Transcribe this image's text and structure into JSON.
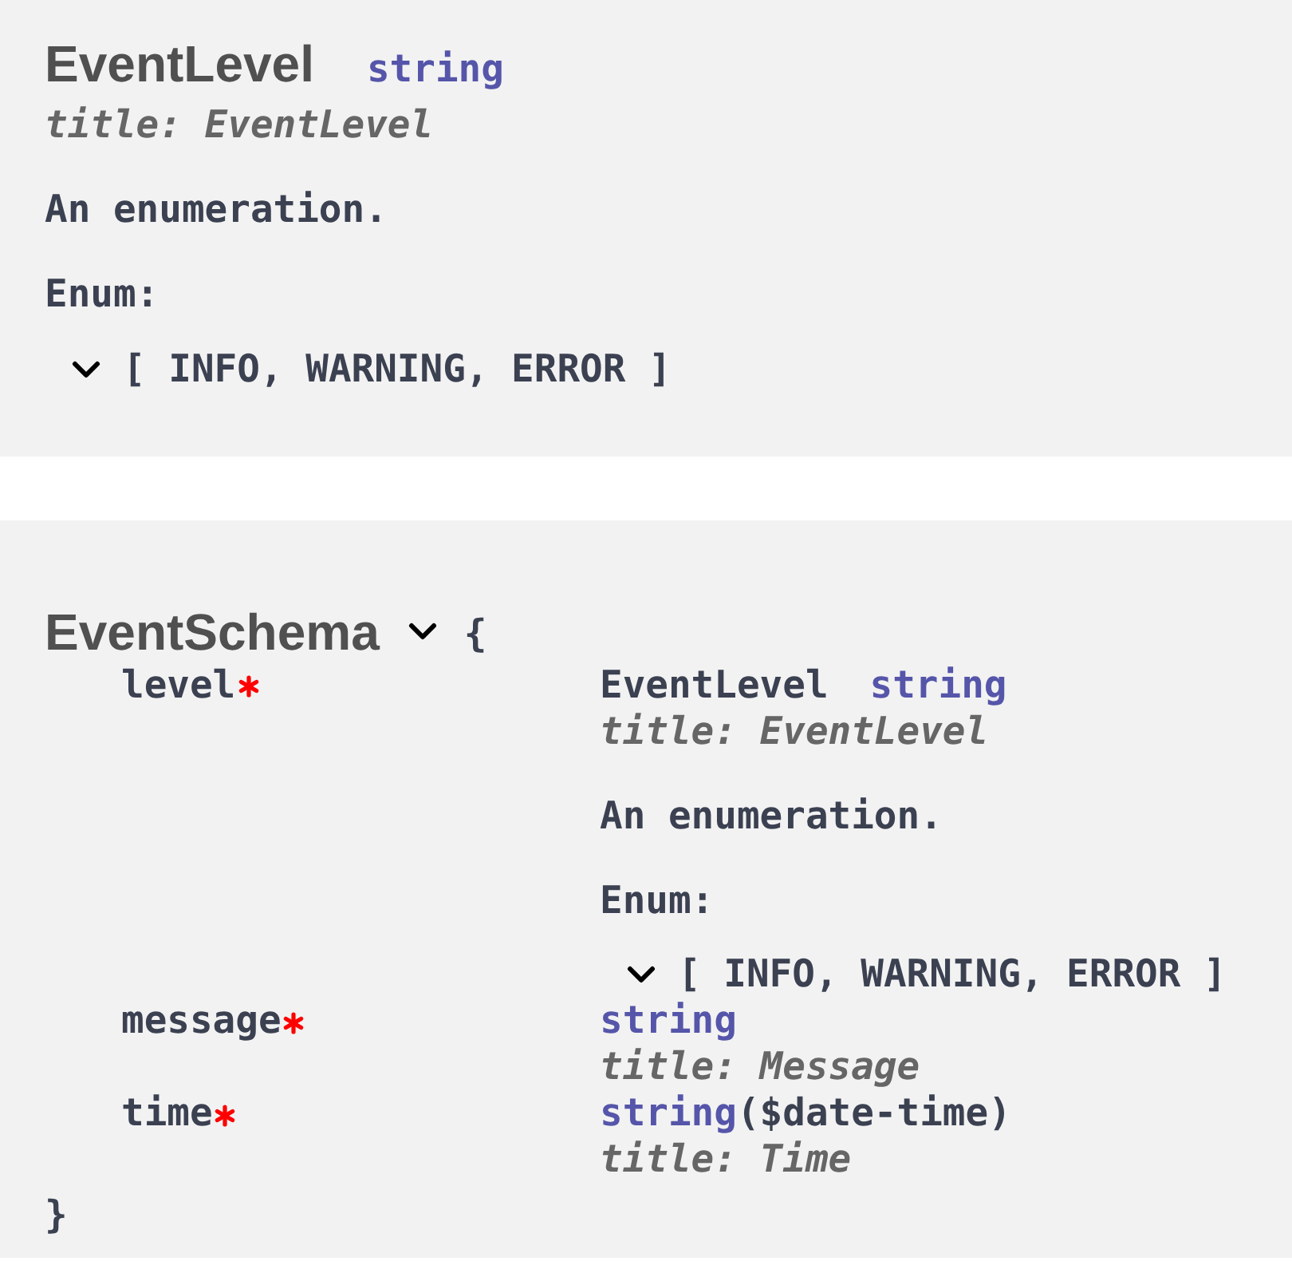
{
  "models": [
    {
      "kind": "enum",
      "name": "EventLevel",
      "type": "string",
      "title": "title: EventLevel",
      "description": "An enumeration.",
      "enum_label": "Enum:",
      "enum": {
        "expanded": true,
        "values": "[ INFO, WARNING, ERROR ]"
      }
    },
    {
      "kind": "object",
      "name": "EventSchema",
      "expanded": true,
      "open_brace": "{",
      "properties": [
        {
          "name": "level",
          "required": true,
          "value": {
            "kind": "ref",
            "name": "EventLevel",
            "type": "string",
            "title": "title: EventLevel",
            "description": "An enumeration.",
            "enum_label": "Enum:",
            "enum": {
              "expanded": true,
              "values": "[ INFO, WARNING, ERROR ]"
            }
          }
        },
        {
          "name": "message",
          "required": true,
          "value": {
            "kind": "primitive",
            "type": "string",
            "title": "title: Message"
          }
        },
        {
          "name": "time",
          "required": true,
          "value": {
            "kind": "primitive",
            "type": "string",
            "format": "($date-time)",
            "title": "title: Time"
          }
        }
      ],
      "close_brace": "}"
    }
  ]
}
